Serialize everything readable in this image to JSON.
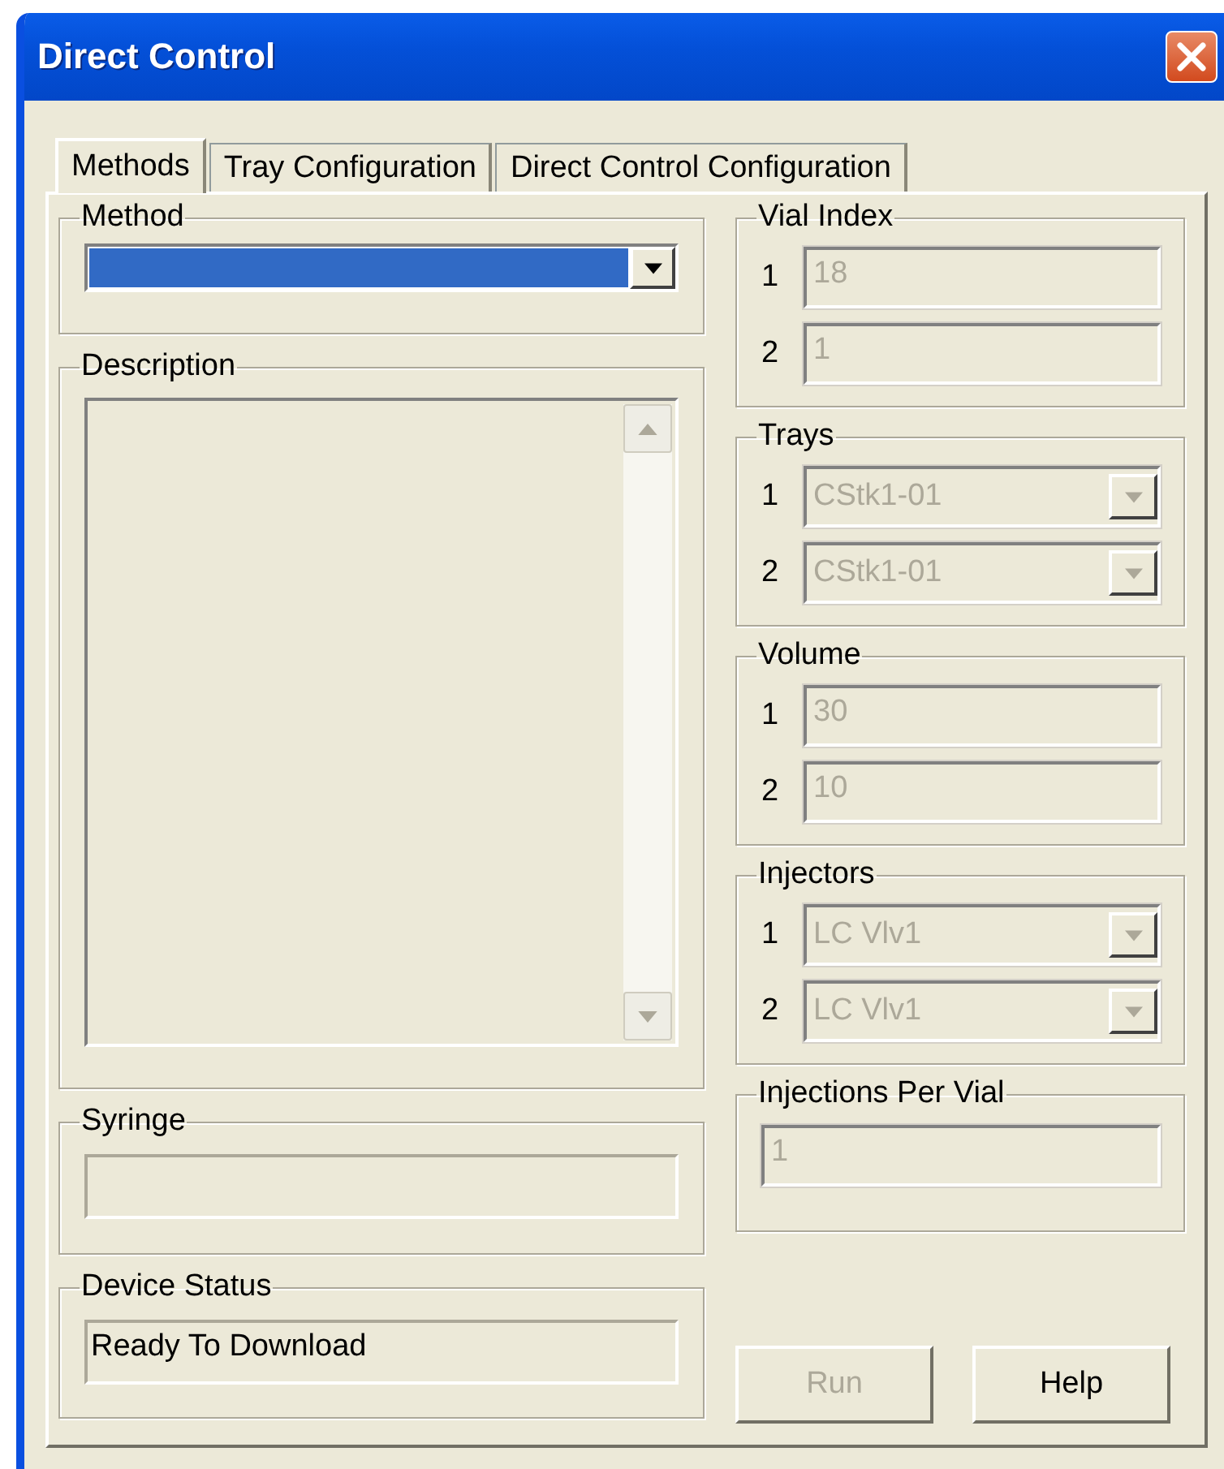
{
  "window": {
    "title": "Direct Control"
  },
  "tabs": [
    {
      "label": "Methods",
      "selected": true
    },
    {
      "label": "Tray Configuration",
      "selected": false
    },
    {
      "label": "Direct Control Configuration",
      "selected": false
    }
  ],
  "method": {
    "label": "Method",
    "highlighted": true
  },
  "description": {
    "label": "Description"
  },
  "syringe": {
    "label": "Syringe"
  },
  "device_status": {
    "label": "Device Status",
    "value": "Ready To Download"
  },
  "groups": [
    {
      "label": "Vial Index",
      "kind": "text",
      "disabled": true,
      "rows": [
        {
          "index": "1",
          "value": "18"
        },
        {
          "index": "2",
          "value": "1"
        }
      ]
    },
    {
      "label": "Trays",
      "kind": "dropdown",
      "disabled": true,
      "rows": [
        {
          "index": "1",
          "value": "CStk1-01"
        },
        {
          "index": "2",
          "value": "CStk1-01"
        }
      ]
    },
    {
      "label": "Volume",
      "kind": "text",
      "disabled": true,
      "rows": [
        {
          "index": "1",
          "value": "30"
        },
        {
          "index": "2",
          "value": "10"
        }
      ]
    },
    {
      "label": "Injectors",
      "kind": "dropdown",
      "disabled": true,
      "rows": [
        {
          "index": "1",
          "value": "LC Vlv1"
        },
        {
          "index": "2",
          "value": "LC Vlv1"
        }
      ]
    }
  ],
  "injections_per_vial": {
    "label": "Injections Per Vial",
    "value": "1",
    "disabled": true
  },
  "buttons": [
    {
      "label": "Run",
      "disabled": true
    },
    {
      "label": "Help",
      "disabled": false
    }
  ]
}
